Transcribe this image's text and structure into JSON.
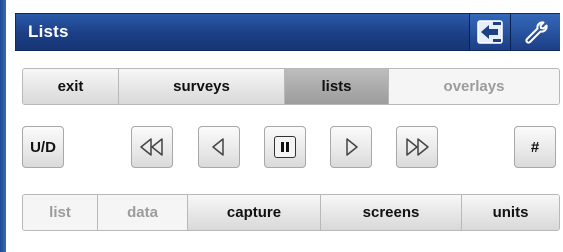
{
  "titlebar": {
    "title": "Lists",
    "back_icon": "back-arrow-icon",
    "settings_icon": "wrench-icon"
  },
  "tabs_top": [
    {
      "label": "exit",
      "state": "normal"
    },
    {
      "label": "surveys",
      "state": "normal"
    },
    {
      "label": "lists",
      "state": "active"
    },
    {
      "label": "overlays",
      "state": "disabled"
    }
  ],
  "playback": {
    "ud_label": "U/D",
    "hash_label": "#",
    "controls": [
      "rewind-icon",
      "step-back-icon",
      "pause-icon",
      "step-forward-icon",
      "fast-forward-icon"
    ]
  },
  "tabs_bottom": [
    {
      "label": "list",
      "state": "disabled"
    },
    {
      "label": "data",
      "state": "disabled"
    },
    {
      "label": "capture",
      "state": "normal"
    },
    {
      "label": "screens",
      "state": "normal"
    },
    {
      "label": "units",
      "state": "normal"
    }
  ],
  "colors": {
    "titlebar": "#1c3f86",
    "active_tab": "#a9a9a9",
    "disabled_text": "#9c9c9c"
  }
}
